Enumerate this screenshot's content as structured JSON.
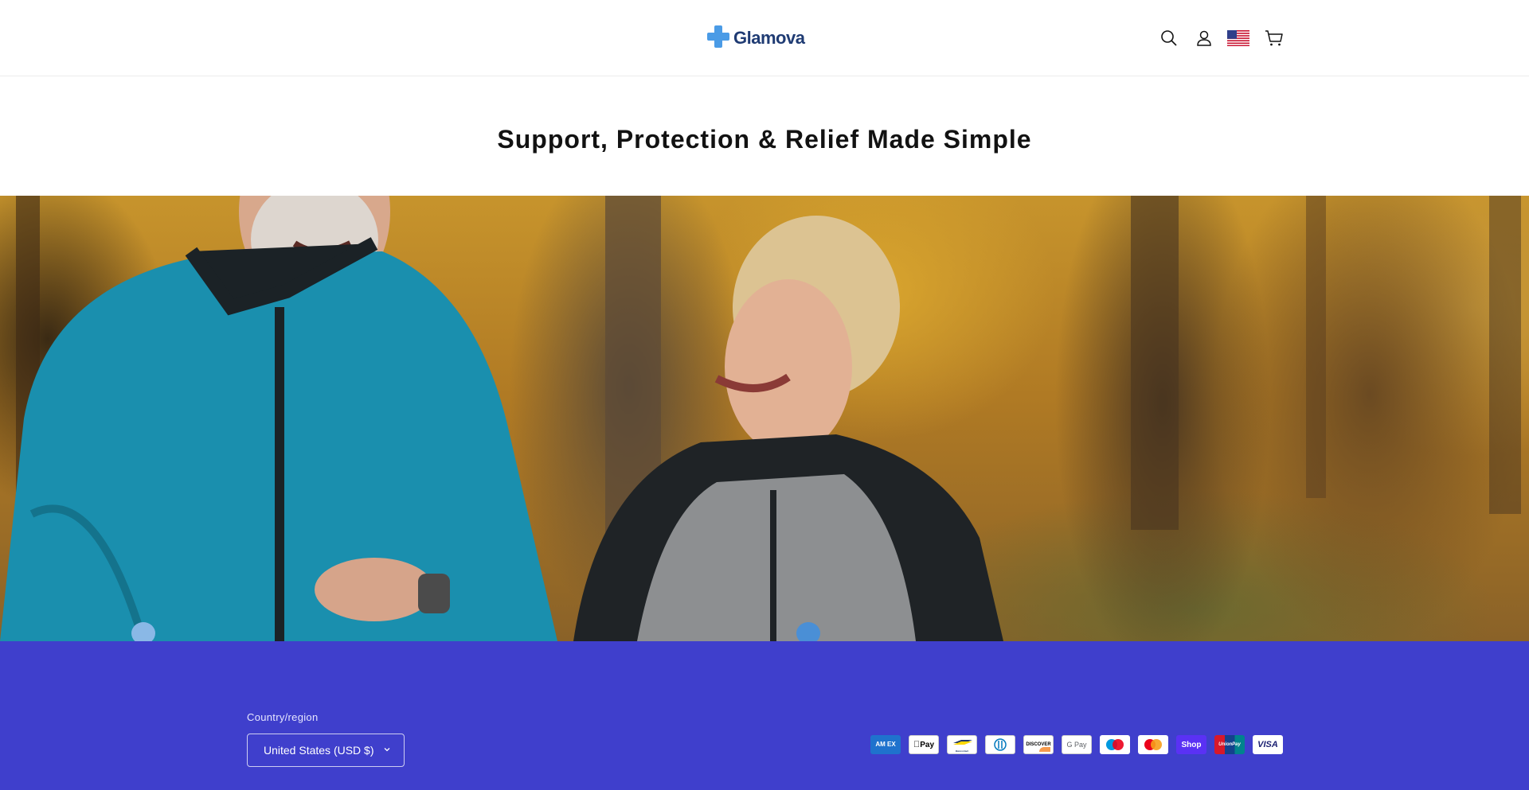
{
  "header": {
    "logo_text": "Glamova",
    "icons": [
      "search-icon",
      "account-icon",
      "us-flag-icon",
      "cart-icon"
    ]
  },
  "main": {
    "title": "Support, Protection & Relief Made Simple"
  },
  "footer": {
    "country_label": "Country/region",
    "country_value": "United States (USD $)",
    "payment_methods": [
      {
        "name": "American Express",
        "label": "AM EX"
      },
      {
        "name": "Apple Pay",
        "label": "Pay"
      },
      {
        "name": "Bancontact",
        "label": "Bancontact"
      },
      {
        "name": "Diners Club",
        "label": "D"
      },
      {
        "name": "Discover",
        "label": "DISCOVER"
      },
      {
        "name": "Google Pay",
        "label": "G Pay"
      },
      {
        "name": "Maestro",
        "label": ""
      },
      {
        "name": "Mastercard",
        "label": ""
      },
      {
        "name": "Shop Pay",
        "label": "Shop"
      },
      {
        "name": "UnionPay",
        "label": "UnionPay"
      },
      {
        "name": "Visa",
        "label": "VISA"
      }
    ]
  },
  "colors": {
    "footer_bg": "#3f3fcc",
    "logo_cross": "#4a9be6",
    "logo_text": "#1f3b73"
  }
}
